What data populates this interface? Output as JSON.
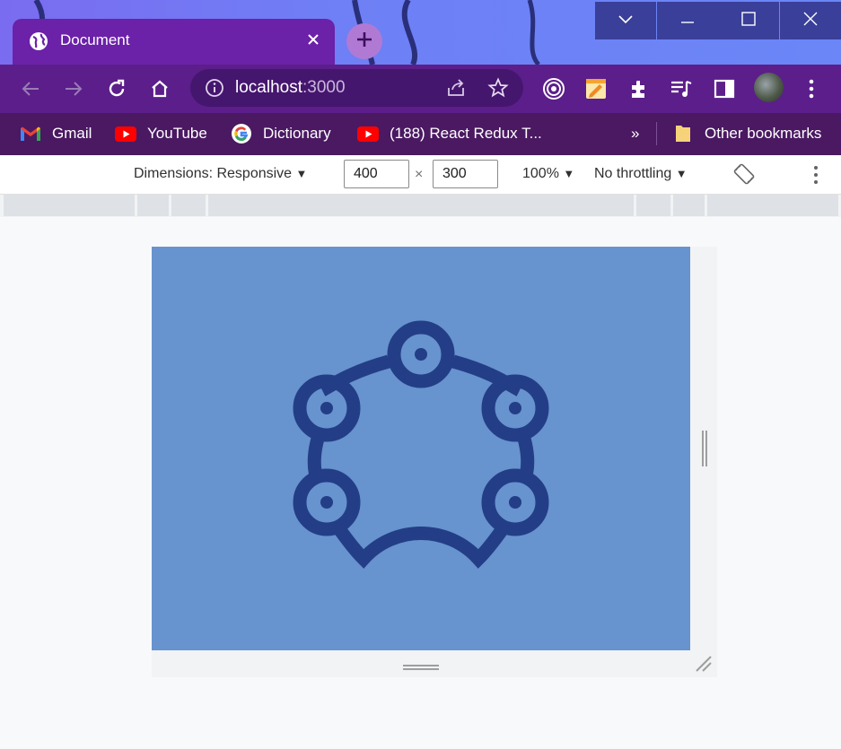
{
  "browser": {
    "tab": {
      "title": "Document",
      "favicon": "globe-icon"
    },
    "window_controls": [
      "chevron-down-icon",
      "minimize-icon",
      "maximize-icon",
      "close-icon"
    ],
    "address": {
      "host": "localhost",
      "port": ":3000"
    },
    "toolbar_icons": [
      "back-icon",
      "forward-icon",
      "reload-icon",
      "home-icon",
      "info-icon",
      "share-icon",
      "star-icon",
      "extension-record-icon",
      "notes-icon",
      "puzzle-icon",
      "media-icon",
      "sidepanel-icon",
      "avatar",
      "kebab-icon"
    ]
  },
  "bookmarks": {
    "items": [
      {
        "label": "Gmail",
        "icon": "gmail-icon"
      },
      {
        "label": "YouTube",
        "icon": "youtube-icon"
      },
      {
        "label": "Dictionary",
        "icon": "google-icon"
      },
      {
        "label": "(188) React Redux T...",
        "icon": "youtube-icon"
      }
    ],
    "overflow": "»",
    "other": "Other bookmarks"
  },
  "devtools": {
    "dimensions_label": "Dimensions: Responsive",
    "width": "400",
    "height": "300",
    "times": "×",
    "zoom": "100%",
    "throttling": "No throttling"
  },
  "colors": {
    "tab_bg": "#6b21a8",
    "toolbar_bg": "#5c1e8a",
    "bookmarks_bg": "#4a1962",
    "screen_bg": "#6793cf",
    "logo_color": "#233e86"
  },
  "content": {
    "logo": "network-nodes-icon"
  }
}
